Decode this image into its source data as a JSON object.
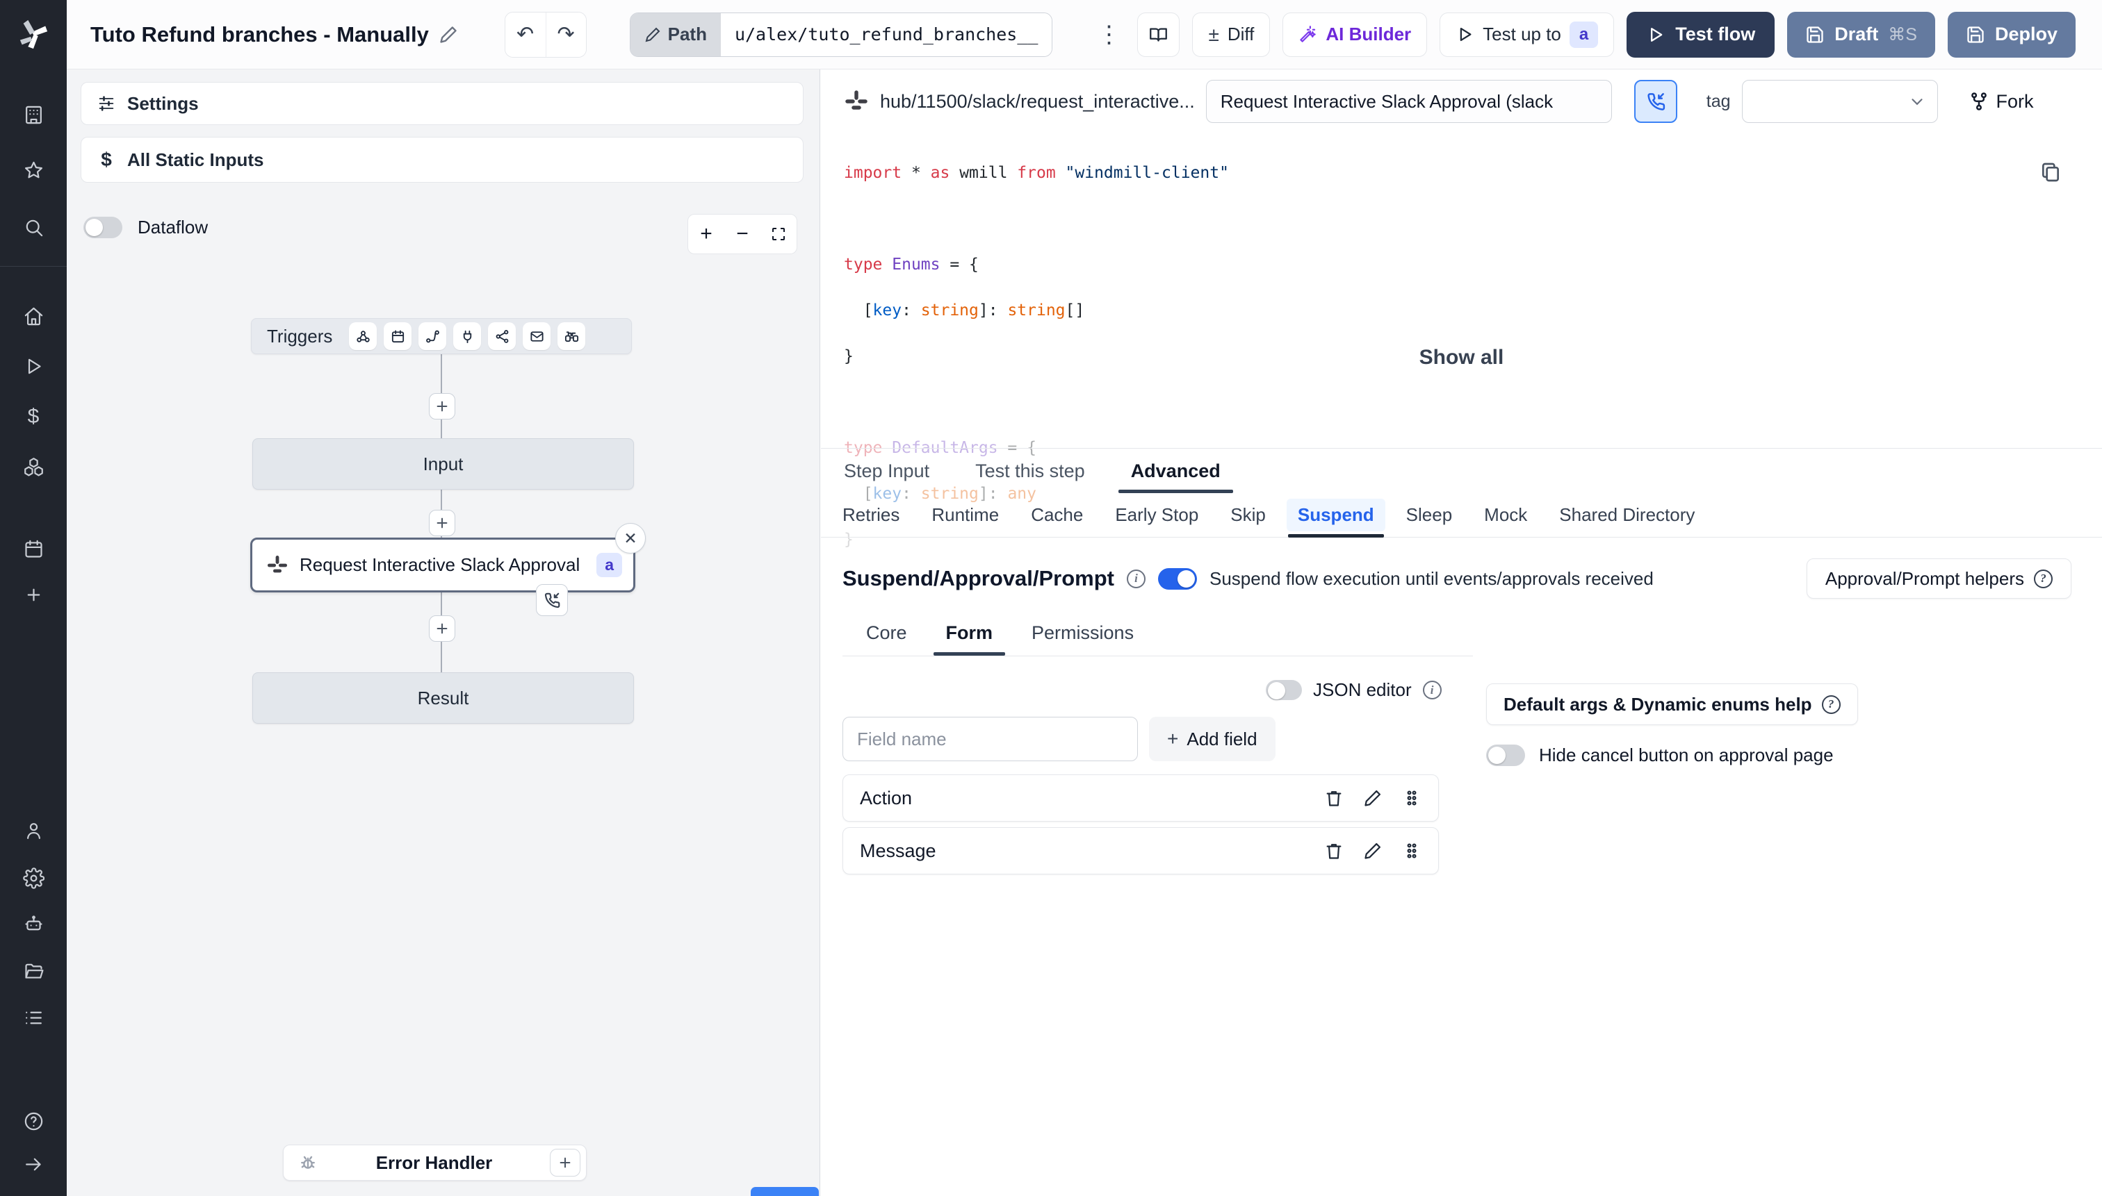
{
  "colors": {
    "accent_blue": "#2563eb",
    "suspend_tab_blue": "#2563eb",
    "test_flow_bg": "#2d3a56",
    "draft_deploy_bg": "#647a9f",
    "ai_builder_purple": "#7c3aed",
    "badge_bg": "#e0e7ff",
    "badge_text": "#4338ca",
    "sidebar_bg": "#21252d",
    "flow_panel_bg": "#f3f4f6",
    "selected_node_border": "#5f6a80"
  },
  "icons": {
    "undo": "↶",
    "redo": "↷",
    "kebab": "⋮",
    "diff_sign": "±",
    "dollar": "$",
    "close": "✕",
    "question": "?",
    "info": "i",
    "gear": "⚙",
    "plus": "+",
    "minus": "−"
  },
  "topbar": {
    "title": "Tuto Refund branches - Manually",
    "path_label": "Path",
    "path_value": "u/alex/tuto_refund_branches__",
    "diff_label": "Diff",
    "ai_builder_label": "AI Builder",
    "test_up_to_label": "Test up to",
    "test_up_to_badge": "a",
    "test_flow_label": "Test flow",
    "draft_label": "Draft",
    "draft_shortcut": "⌘S",
    "deploy_label": "Deploy"
  },
  "flow_panel": {
    "settings_label": "Settings",
    "static_inputs_label": "All Static Inputs",
    "dataflow_label": "Dataflow",
    "graph": {
      "triggers_label": "Triggers",
      "input_label": "Input",
      "step_label": "Request Interactive Slack Approval (...",
      "step_badge": "a",
      "result_label": "Result",
      "error_handler_label": "Error Handler"
    }
  },
  "editor": {
    "header": {
      "hub_path": "hub/11500/slack/request_interactive...",
      "name_value": "Request Interactive Slack Approval (slack",
      "tag_label": "tag",
      "fork_label": "Fork"
    },
    "code": {
      "l1": {
        "kw1": "import",
        "p1": " * ",
        "kw2": "as",
        "p2": " wmill ",
        "kw3": "from ",
        "str1": "\"windmill-client\""
      },
      "l3": {
        "kw": "type ",
        "name": "Enums",
        "rest": " = {"
      },
      "l4": {
        "p1": "  [",
        "prop": "key",
        "p2": ": ",
        "t1": "string",
        "p3": "]: ",
        "t2": "string",
        "p4": "[]"
      },
      "l5": "}",
      "l7": {
        "kw": "type ",
        "name": "DefaultArgs",
        "rest": " = {"
      },
      "l8": {
        "p1": "  [",
        "prop": "key",
        "p2": ": ",
        "t1": "string",
        "p3": "]: ",
        "t2": "any"
      },
      "l9": "}"
    },
    "show_all_label": "Show all",
    "tabs": [
      "Step Input",
      "Test this step",
      "Advanced"
    ],
    "subtabs": [
      "Retries",
      "Runtime",
      "Cache",
      "Early Stop",
      "Skip",
      "Suspend",
      "Sleep",
      "Mock",
      "Shared Directory"
    ],
    "suspend": {
      "heading": "Suspend/Approval/Prompt",
      "toggle_desc": "Suspend flow execution until events/approvals received",
      "helpers_button": "Approval/Prompt helpers",
      "inner_tabs": [
        "Core",
        "Form",
        "Permissions"
      ],
      "json_editor_label": "JSON editor",
      "field_placeholder": "Field name",
      "add_field_label": "Add field",
      "fields": [
        "Action",
        "Message"
      ],
      "default_args_button": "Default args & Dynamic enums help",
      "hide_cancel_label": "Hide cancel button on approval page"
    }
  }
}
